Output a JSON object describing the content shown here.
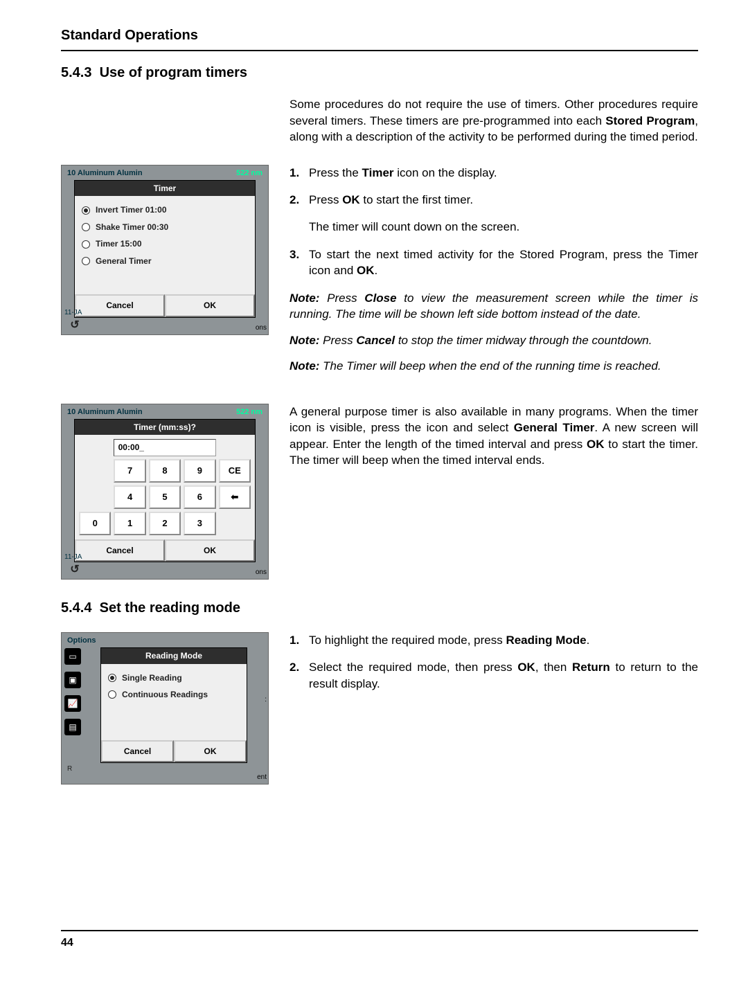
{
  "header": "Standard Operations",
  "section_543_num": "5.4.3",
  "section_543_title": "Use of program timers",
  "intro_1": "Some procedures do not require the use of timers. Other procedures require several timers. These timers are pre-programmed into each ",
  "intro_stored_program": "Stored Program",
  "intro_2": ", along with a description of the activity to be performed during the timed period.",
  "step1_a": "Press the ",
  "step1_b": "Timer",
  "step1_c": " icon on the display.",
  "step2_a": "Press ",
  "step2_b": "OK",
  "step2_c": " to start the first timer.",
  "step2_sub": "The timer will count down on the screen.",
  "step3_a": "To start the next timed activity for the Stored Program, press the Timer icon and ",
  "step3_b": "OK",
  "step3_c": ".",
  "note1_label": "Note:",
  "note1_a": " Press ",
  "note1_b": "Close",
  "note1_c": " to view the measurement screen while the timer is running. The time will be shown left side bottom instead of the date.",
  "note2_a": " Press ",
  "note2_b": "Cancel",
  "note2_c": " to stop the timer midway through the countdown.",
  "note3": " The Timer will beep when the end of the running time is reached.",
  "general_timer_paragraph_a": "A general purpose timer is also available in many programs. When the timer icon is visible, press the icon and select ",
  "general_timer_paragraph_b": "General Timer",
  "general_timer_paragraph_c": ". A new screen will appear. Enter the length of the timed interval and press ",
  "general_timer_paragraph_d": "OK",
  "general_timer_paragraph_e": " to start the timer. The timer will beep when the timed interval ends.",
  "section_544_num": "5.4.4",
  "section_544_title": "Set the reading mode",
  "rm_step1_a": "To highlight the required mode, press ",
  "rm_step1_b": "Reading Mode",
  "rm_step1_c": ".",
  "rm_step2_a": "Select the required mode, then press ",
  "rm_step2_b": "OK",
  "rm_step2_c": ", then ",
  "rm_step2_d": "Return",
  "rm_step2_e": " to return to the result display.",
  "page_number": "44",
  "dev1": {
    "top_left": "10 Aluminum Alumin",
    "top_right": "522 nm",
    "title": "Timer",
    "opt1": "Invert Timer 01:00",
    "opt2": "Shake Timer 00:30",
    "opt3": "Timer 15:00",
    "opt4": "General Timer",
    "cancel": "Cancel",
    "ok": "OK",
    "date": "11-JA",
    "ons": "ons"
  },
  "dev2": {
    "top_left": "10 Aluminum Alumin",
    "top_right": "522 nm",
    "title": "Timer (mm:ss)?",
    "input": "00:00_",
    "k7": "7",
    "k8": "8",
    "k9": "9",
    "kce": "CE",
    "k4": "4",
    "k5": "5",
    "k6": "6",
    "kback": "⬅",
    "k0": "0",
    "k1": "1",
    "k2": "2",
    "k3": "3",
    "cancel": "Cancel",
    "ok": "OK",
    "date": "11-JA",
    "ons": "ons"
  },
  "dev3": {
    "top_left": "Options",
    "title": "Reading Mode",
    "opt1": "Single Reading",
    "opt2": "Continuous Readings",
    "cancel": "Cancel",
    "ok": "OK",
    "right_txt": "ent",
    "side_colon": ":"
  }
}
